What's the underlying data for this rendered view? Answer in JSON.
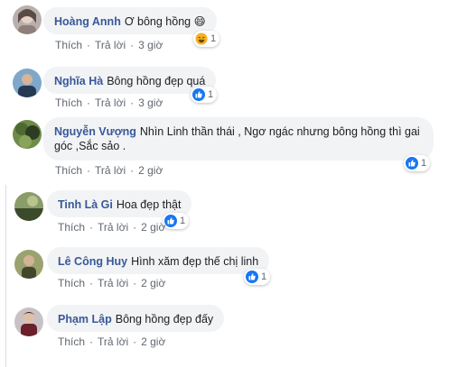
{
  "comments": [
    {
      "author": "Hoàng Annh",
      "text": "Ơ bông hồng 😄",
      "like_label": "Thích",
      "reply_label": "Trả lời",
      "time": "3 giờ",
      "reaction": {
        "icon": "haha-icon",
        "count": "1"
      },
      "avatar_colors": [
        "#b9b0ad",
        "#5b4a45"
      ]
    },
    {
      "author": "Nghĩa Hà",
      "text": "Bông hồng đẹp quá",
      "like_label": "Thích",
      "reply_label": "Trả lời",
      "time": "3 giờ",
      "reaction": {
        "icon": "like-icon",
        "count": "1"
      },
      "avatar_colors": [
        "#7fa7c9",
        "#263a56"
      ]
    },
    {
      "author": "Nguyễn Vượng",
      "text": "Nhìn Linh thần thái , Ngơ ngác nhưng bông hồng thì gai góc ,Sắc sảo .",
      "like_label": "Thích",
      "reply_label": "Trả lời",
      "time": "2 giờ",
      "reaction": {
        "icon": "like-icon",
        "count": "1"
      },
      "avatar_colors": [
        "#6f8b4a",
        "#2d3b22"
      ]
    },
    {
      "author": "Tinh Là Gi",
      "text": "Hoa đẹp thật",
      "like_label": "Thích",
      "reply_label": "Trả lời",
      "time": "2 giờ",
      "reaction": {
        "icon": "like-icon",
        "count": "1"
      },
      "avatar_colors": [
        "#8a9c6a",
        "#3a4a2a"
      ]
    },
    {
      "author": "Lê Công Huy",
      "text": "Hình xăm đẹp thế chị linh",
      "like_label": "Thích",
      "reply_label": "Trả lời",
      "time": "2 giờ",
      "reaction": {
        "icon": "like-icon",
        "count": "1"
      },
      "avatar_colors": [
        "#9aa36f",
        "#43462c"
      ]
    },
    {
      "author": "Phạm Lập",
      "text": "Bông hồng đẹp đấy",
      "like_label": "Thích",
      "reply_label": "Trả lời",
      "time": "2 giờ",
      "reaction": null,
      "avatar_colors": [
        "#c9c2c4",
        "#6b1f2a"
      ]
    }
  ],
  "colors": {
    "author_link": "#385898",
    "bubble_bg": "#f2f3f5",
    "meta_text": "#606770",
    "like_blue": "#1877f2",
    "haha_yellow": "#f7b125"
  }
}
